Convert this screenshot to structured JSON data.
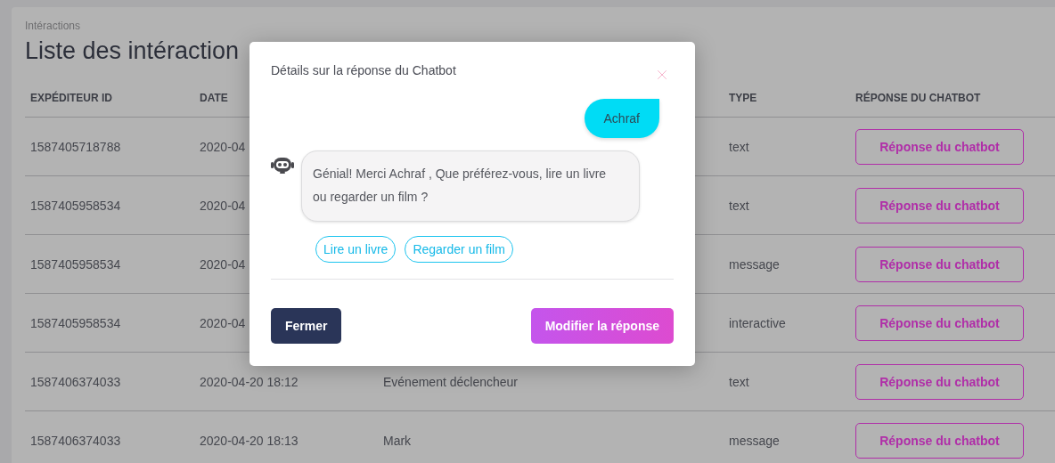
{
  "breadcrumb": "Intéractions",
  "title": "Liste des intéraction",
  "table": {
    "headers": {
      "sender_id": "EXPÉDITEUR ID",
      "date": "DATE",
      "type": "TYPE",
      "response": "RÉPONSE DU CHATBOT"
    },
    "rows": [
      {
        "sender_id": "1587405718788",
        "date": "2020-04",
        "type": "text",
        "action": "Réponse du chatbot"
      },
      {
        "sender_id": "1587405958534",
        "date": "2020-04",
        "type": "text",
        "action": "Réponse du chatbot"
      },
      {
        "sender_id": "1587405958534",
        "date": "2020-04",
        "type": "message",
        "action": "Réponse du chatbot"
      },
      {
        "sender_id": "1587405958534",
        "date": "2020-04",
        "type": "interactive",
        "action": "Réponse du chatbot"
      },
      {
        "sender_id": "1587406374033",
        "date": "2020-04-20 18:12",
        "event": "Evénement déclencheur",
        "type": "text",
        "action": "Réponse du chatbot"
      },
      {
        "sender_id": "1587406374033",
        "date": "2020-04-20 18:13",
        "event": "Mark",
        "type": "message",
        "action": "Réponse du chatbot"
      }
    ]
  },
  "modal": {
    "title": "Détails sur la réponse du Chatbot",
    "messages": [
      {
        "kind": "user",
        "text": "Achraf"
      },
      {
        "kind": "bot",
        "text": "Génial! Merci Achraf , Que préférez-vous, lire un livre ou regarder un film ?",
        "quick_replies": [
          "Lire un livre",
          "Regarder un film"
        ]
      }
    ],
    "buttons": {
      "close": "Fermer",
      "edit": "Modifier la réponse"
    }
  }
}
